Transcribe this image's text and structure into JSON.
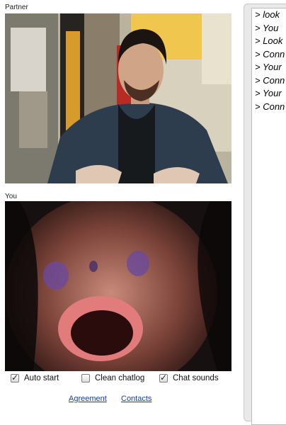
{
  "partner": {
    "label": "Partner"
  },
  "you": {
    "label": "You"
  },
  "controls": [
    {
      "label": "Auto start",
      "checked": true
    },
    {
      "label": "Clean chatlog",
      "checked": false
    },
    {
      "label": "Chat sounds",
      "checked": true
    }
  ],
  "links": {
    "agreement": "Agreement",
    "contacts": "Contacts"
  },
  "chatlog": {
    "lines": [
      "> look",
      "> You",
      "> Look",
      "> Conn",
      "> Your",
      "> Conn",
      "> Your",
      "> Conn"
    ]
  }
}
